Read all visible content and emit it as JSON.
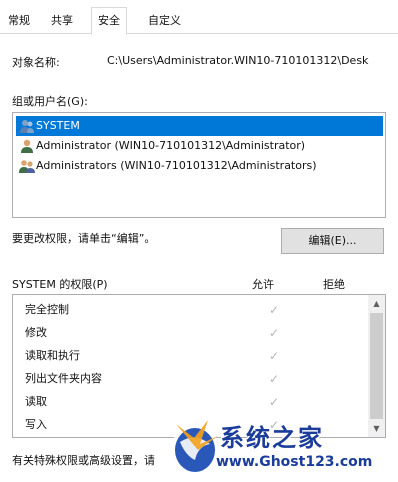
{
  "tabs": [
    "常规",
    "共享",
    "安全",
    "自定义"
  ],
  "object_name": {
    "label": "对象名称:",
    "value": "C:\\Users\\Administrator.WIN10-710101312\\Desk"
  },
  "groups": {
    "label": "组或用户名(G):",
    "items": [
      {
        "name": "SYSTEM",
        "selected": true
      },
      {
        "name": "Administrator (WIN10-710101312\\Administrator)",
        "selected": false
      },
      {
        "name": "Administrators (WIN10-710101312\\Administrators)",
        "selected": false
      }
    ]
  },
  "edit_hint": "要更改权限，请单击“编辑”。",
  "edit_button": "编辑(E)...",
  "permissions": {
    "label": "SYSTEM 的权限(P)",
    "allow_header": "允许",
    "deny_header": "拒绝",
    "rows": [
      {
        "name": "完全控制",
        "allow": true,
        "deny": false
      },
      {
        "name": "修改",
        "allow": true,
        "deny": false
      },
      {
        "name": "读取和执行",
        "allow": true,
        "deny": false
      },
      {
        "name": "列出文件夹内容",
        "allow": true,
        "deny": false
      },
      {
        "name": "读取",
        "allow": true,
        "deny": false
      },
      {
        "name": "写入",
        "allow": true,
        "deny": false
      }
    ]
  },
  "bottom_hint": "有关特殊权限或高级设置，请",
  "watermark": {
    "title": "系统之家",
    "url": "www.Ghost123.com"
  },
  "icons": {
    "user": "users-icon",
    "check": "checkmark-icon",
    "logo": "globe-logo-icon"
  }
}
